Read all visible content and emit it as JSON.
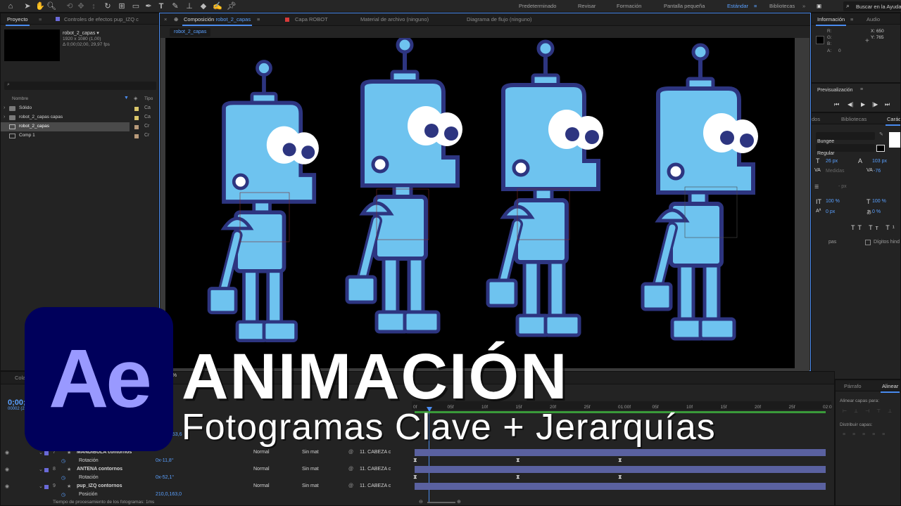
{
  "toolbar": {
    "workspaces": [
      "Predeterminado",
      "Revisar",
      "Formación",
      "Pantalla pequeña",
      "Estándar",
      "Bibliotecas"
    ],
    "active_workspace": "Estándar",
    "search_placeholder": "Buscar en la Ayuda"
  },
  "project_panel": {
    "tabs": [
      "Proyecto",
      "Controles de efectos pup_IZQ c"
    ],
    "selected_item": {
      "name": "robot_2_capas ▾",
      "info1": "1920 x 1080 (1,00)",
      "info2": "Δ 0;00;02;00, 29,97 fps"
    },
    "columns": {
      "name": "Nombre",
      "type": "Tipo"
    },
    "items": [
      {
        "name": "Sólido",
        "type": "Ca",
        "color": "#d9c56a",
        "kind": "folder"
      },
      {
        "name": "robot_2_capas capas",
        "type": "Ca",
        "color": "#d9c56a",
        "kind": "folder"
      },
      {
        "name": "robot_2_capas",
        "type": "Cr",
        "color": "#b89a7a",
        "kind": "comp"
      },
      {
        "name": "Comp 1",
        "type": "Cr",
        "color": "#b89a7a",
        "kind": "comp"
      }
    ]
  },
  "comp_panel": {
    "tabs": [
      "Composición robot_2_capas",
      "Capa ROBOT",
      "Material de archivo (ninguno)",
      "Diagrama de flujo (ninguno)"
    ],
    "tab_prefix": "Composición",
    "tab_comp": "robot_2_capas",
    "breadcrumb": "robot_2_capas"
  },
  "info_panel": {
    "tabs": [
      "Información",
      "Audio"
    ],
    "r": "R:",
    "g": "G:",
    "b": "B:",
    "a": "A:",
    "a_val": "0",
    "x": "X: 650",
    "y": "Y: 765"
  },
  "preview_panel": {
    "title": "Previsualización"
  },
  "character_panel": {
    "tabs": [
      "dos",
      "Bibliotecas",
      "Caráct"
    ],
    "font": "Bungee",
    "style": "Regular",
    "size": "26 px",
    "leading": "103 px",
    "kerning": "Medidas",
    "tracking": "-76",
    "line_px": "- px",
    "vscale": "100 %",
    "hscale": "100 %",
    "baseline": "0 px",
    "tsume": "0 %",
    "ligatures": "pas",
    "hindi": "Dígitos hind"
  },
  "align_panel": {
    "tabs": [
      "Párrafo",
      "Alinear"
    ],
    "align_to": "Alinear capas para:",
    "distribute": "Distribuir capas:"
  },
  "timeline": {
    "timecode": "0;00;0",
    "frames": "00002 (2",
    "ruler": [
      "0f",
      "05f",
      "10f",
      "15f",
      "20f",
      "25f",
      "01:00f",
      "05f",
      "10f",
      "15f",
      "20f",
      "25f",
      "02:0"
    ],
    "layers": [
      {
        "num": "7",
        "name": "MANDÍBULA contornos",
        "mode": "Normal",
        "track": "Sin mat",
        "parent": "11. CABEZA c",
        "color": "#6a6ad8"
      },
      {
        "num": "",
        "name": "Rotación",
        "value": "0x-11,8°",
        "prop": true
      },
      {
        "num": "8",
        "name": "ANTENA contornos",
        "mode": "Normal",
        "track": "Sin mat",
        "parent": "11. CABEZA c",
        "color": "#6a6ad8"
      },
      {
        "num": "",
        "name": "Rotación",
        "value": "0x-52,1°",
        "prop": true
      },
      {
        "num": "9",
        "name": "pup_IZQ contornos",
        "mode": "Normal",
        "track": "Sin mat",
        "parent": "11. CABEZA c",
        "color": "#6a6ad8"
      },
      {
        "num": "",
        "name": "Posición",
        "value": "210,0,163,0",
        "prop": true
      }
    ],
    "partial_value": "153,6",
    "status": "Tiempo de procesamiento de los fotogramas: 1ms"
  },
  "zoom": "0%",
  "overlay": {
    "logo": "Ae",
    "title": "ANIMACIÓN",
    "subtitle": "Fotogramas Clave + Jerarquías"
  }
}
